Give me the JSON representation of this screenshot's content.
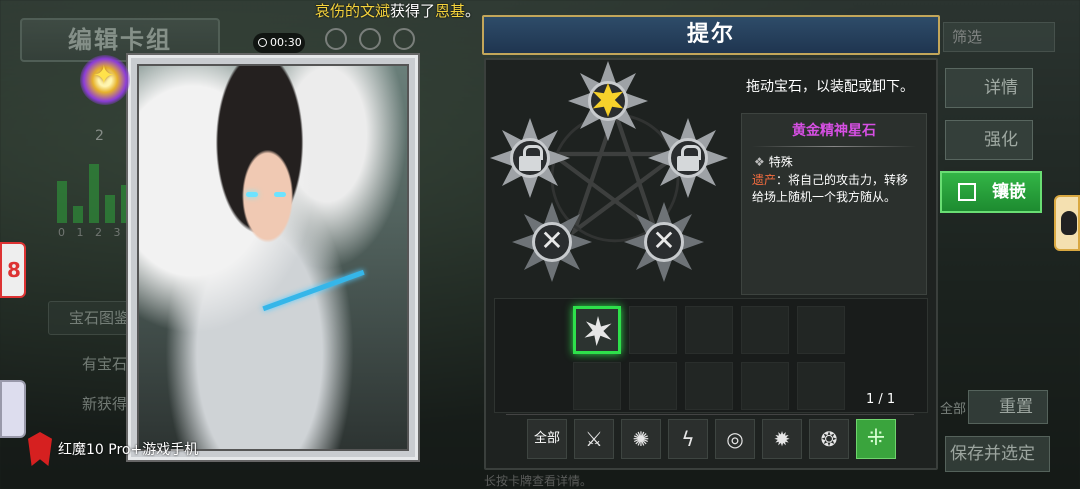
{
  "notification": {
    "player": "哀伤的文斌",
    "action": "获得了",
    "reward": "恩基",
    "end": "。"
  },
  "timer": "00:30",
  "left_panel": {
    "title": "编辑卡组",
    "count": "2",
    "axis": "0 1 2 3",
    "bars": [
      0.6,
      0.25,
      0.85,
      0.4,
      0.55
    ],
    "gem_guide": "宝石图鉴",
    "has_gem": "有宝石",
    "new_get": "新获得"
  },
  "character": {
    "name": "提尔"
  },
  "socket_panel": {
    "hint": "拖动宝石，以装配或卸下。",
    "sockets": [
      {
        "state": "equipped",
        "icon": "gold-star-gem-icon"
      },
      {
        "state": "locked",
        "icon": "lock-icon"
      },
      {
        "state": "locked",
        "icon": "lock-icon"
      },
      {
        "state": "disabled",
        "icon": "x-icon"
      },
      {
        "state": "disabled",
        "icon": "x-icon"
      }
    ]
  },
  "gem_info": {
    "name": "黄金精神星石",
    "type": "特殊",
    "desc_keyword": "遗产",
    "desc": "：将自己的攻击力，转移给场上随机一个我方随从。"
  },
  "inventory": {
    "count": "1 / 1",
    "filters": [
      {
        "label": "全部",
        "icon": ""
      },
      {
        "label": "",
        "icon": "sword-icon"
      },
      {
        "label": "",
        "icon": "burst-icon"
      },
      {
        "label": "",
        "icon": "lightning-icon"
      },
      {
        "label": "",
        "icon": "swirl-icon"
      },
      {
        "label": "",
        "icon": "spark-icon"
      },
      {
        "label": "",
        "icon": "vortex-icon"
      },
      {
        "label": "",
        "icon": "grid-diamond-icon"
      }
    ]
  },
  "right_panel": {
    "filter": "筛选",
    "details": "详情",
    "enhance": "强化",
    "embed": "镶嵌",
    "all": "全部",
    "reset": "重置",
    "save": "保存并选定"
  },
  "footer": {
    "tip": "长按卡牌查看详情。",
    "brand": "红魔10 Pro+游戏手机"
  },
  "colors": {
    "accent_green": "#2ee04b",
    "gem_name": "#d64fe3",
    "keyword": "#f36c3f",
    "title_bar": "#2e4c69"
  }
}
